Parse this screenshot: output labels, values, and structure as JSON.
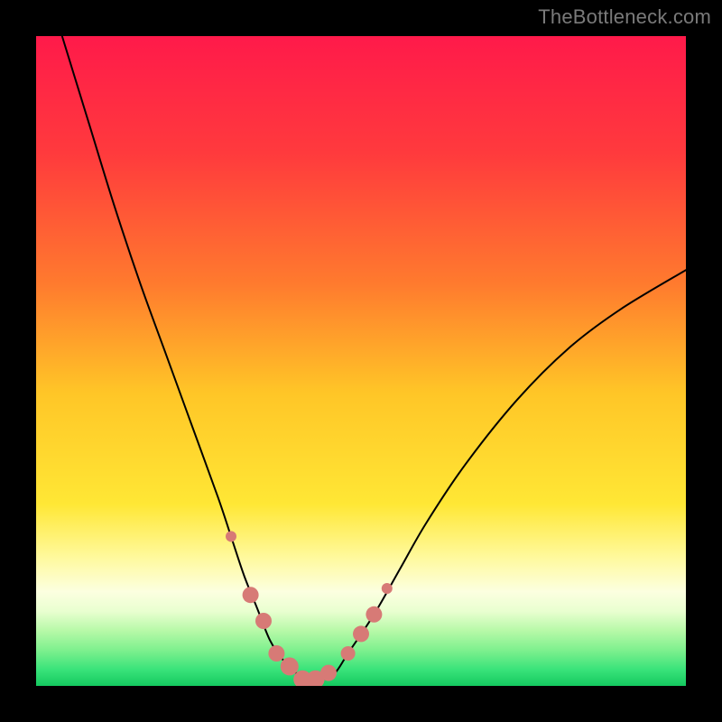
{
  "watermark": "TheBottleneck.com",
  "chart_data": {
    "type": "line",
    "title": "",
    "xlabel": "",
    "ylabel": "",
    "xlim": [
      0,
      100
    ],
    "ylim": [
      0,
      100
    ],
    "grid": false,
    "legend": false,
    "gradient_stops": [
      {
        "offset": 0.0,
        "color": "#ff1a4a"
      },
      {
        "offset": 0.18,
        "color": "#ff3a3d"
      },
      {
        "offset": 0.38,
        "color": "#ff7a2e"
      },
      {
        "offset": 0.55,
        "color": "#ffc627"
      },
      {
        "offset": 0.72,
        "color": "#ffe735"
      },
      {
        "offset": 0.8,
        "color": "#fff99a"
      },
      {
        "offset": 0.855,
        "color": "#fcffe0"
      },
      {
        "offset": 0.885,
        "color": "#e9ffd0"
      },
      {
        "offset": 0.915,
        "color": "#b7f9a8"
      },
      {
        "offset": 0.945,
        "color": "#7ef08e"
      },
      {
        "offset": 0.975,
        "color": "#39e37a"
      },
      {
        "offset": 1.0,
        "color": "#14c95f"
      }
    ],
    "series": [
      {
        "name": "bottleneck-curve",
        "color": "#000000",
        "stroke_width": 2,
        "x": [
          4,
          8,
          12,
          16,
          20,
          24,
          28,
          30,
          32,
          34,
          36,
          38,
          40,
          42,
          44,
          46,
          48,
          52,
          56,
          60,
          66,
          74,
          82,
          90,
          100
        ],
        "y": [
          100,
          87,
          74,
          62,
          51,
          40,
          29,
          23,
          17,
          12,
          7,
          4,
          2,
          1,
          1,
          2,
          5,
          11,
          18,
          25,
          34,
          44,
          52,
          58,
          64
        ]
      }
    ],
    "markers": {
      "name": "highlighted-points",
      "color": "#d77a76",
      "points": [
        {
          "x": 30,
          "y": 23,
          "r": 6
        },
        {
          "x": 33,
          "y": 14,
          "r": 9
        },
        {
          "x": 35,
          "y": 10,
          "r": 9
        },
        {
          "x": 37,
          "y": 5,
          "r": 9
        },
        {
          "x": 39,
          "y": 3,
          "r": 10
        },
        {
          "x": 41,
          "y": 1,
          "r": 10
        },
        {
          "x": 43,
          "y": 1,
          "r": 10
        },
        {
          "x": 45,
          "y": 2,
          "r": 9
        },
        {
          "x": 48,
          "y": 5,
          "r": 8
        },
        {
          "x": 50,
          "y": 8,
          "r": 9
        },
        {
          "x": 52,
          "y": 11,
          "r": 9
        },
        {
          "x": 54,
          "y": 15,
          "r": 6
        }
      ]
    }
  }
}
